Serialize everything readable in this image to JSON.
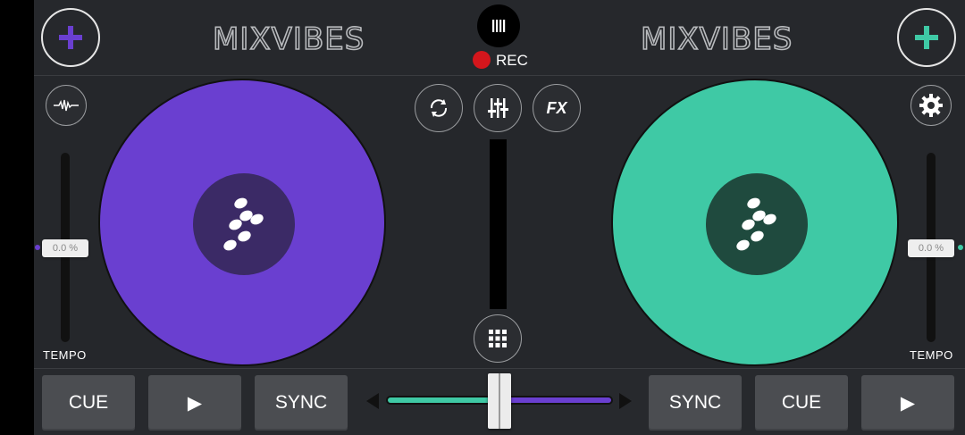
{
  "header": {
    "left_logo": "MIXVIBES",
    "right_logo": "MIXVIBES",
    "rec_label": "REC"
  },
  "colors": {
    "deck_a": "#6a3fd0",
    "deck_b": "#3fc9a5",
    "rec": "#d4161c",
    "background": "#25272b"
  },
  "deck_a": {
    "pitch_value": "0.0 %",
    "tempo_label": "TEMPO",
    "cue_label": "CUE",
    "play_label": "▶",
    "sync_label": "SYNC"
  },
  "deck_b": {
    "pitch_value": "0.0 %",
    "tempo_label": "TEMPO",
    "cue_label": "CUE",
    "play_label": "▶",
    "sync_label": "SYNC"
  },
  "mixer": {
    "fx_label": "FX",
    "crossfader_position": 0.5
  },
  "icons": {
    "add_deck_a": "plus-icon",
    "add_deck_b": "plus-icon",
    "record": "record-icon",
    "waveform": "waveform-icon",
    "loop": "sync-arrows-icon",
    "mixer": "sliders-icon",
    "settings": "gear-icon",
    "samples": "grid-icon"
  }
}
